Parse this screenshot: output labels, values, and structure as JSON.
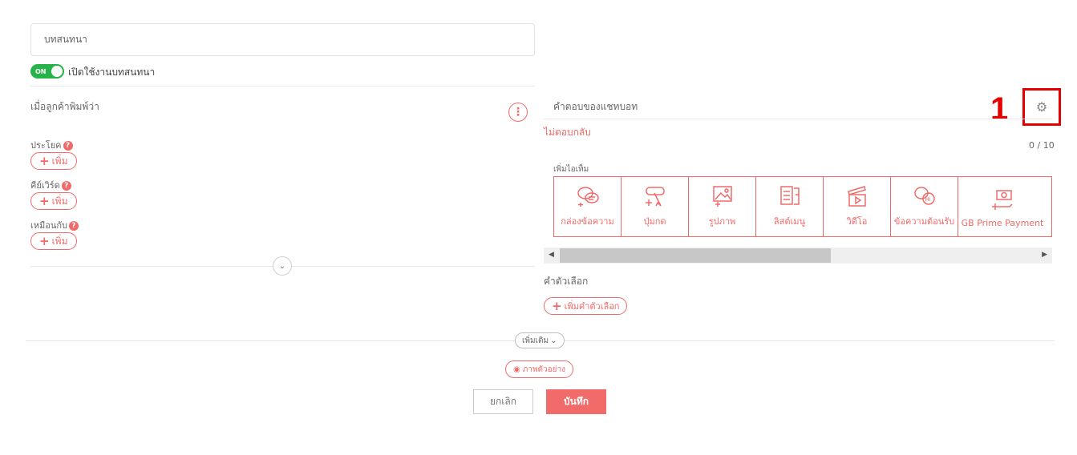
{
  "form": {
    "name_value": "บทสนทนา",
    "toggle_state": "ON",
    "toggle_label": "เปิดใช้งานบทสนทนา"
  },
  "left": {
    "header": "เมื่อลูกค้าพิมพ์ว่า",
    "sentence_label": "ประโยค",
    "keyword_label": "คีย์เวิร์ด",
    "similar_label": "เหมือนกับ",
    "add_label": "เพิ่ม"
  },
  "right": {
    "header": "คำตอบของแชทบอท",
    "number_label": "1",
    "no_reply": "ไม่ตอบกลับ",
    "counter": "0 / 10",
    "add_item_label": "เพิ่มไอเท็ม",
    "items": [
      {
        "label": "กล่องข้อความ",
        "icon": "message-box-icon"
      },
      {
        "label": "ปุ่มกด",
        "icon": "button-icon"
      },
      {
        "label": "รูปภาพ",
        "icon": "image-icon"
      },
      {
        "label": "ลิสต์เมนู",
        "icon": "list-menu-icon"
      },
      {
        "label": "วิดีโอ",
        "icon": "video-icon"
      },
      {
        "label": "ข้อความต้อนรับ",
        "icon": "welcome-message-icon"
      },
      {
        "label": "GB Prime Payment",
        "icon": "payment-icon"
      }
    ],
    "options_label": "คำตัวเลือก",
    "add_option_label": "เพิ่มคำตัวเลือก"
  },
  "footer": {
    "more_label": "เพิ่มเติม",
    "preview_label": "ภาพตัวอย่าง",
    "cancel_label": "ยกเลิก",
    "save_label": "บันทึก"
  },
  "colors": {
    "accent": "#f06a6a",
    "toggle_on": "#27b24a",
    "highlight": "#e40000",
    "save_bg": "#f26b6b"
  }
}
